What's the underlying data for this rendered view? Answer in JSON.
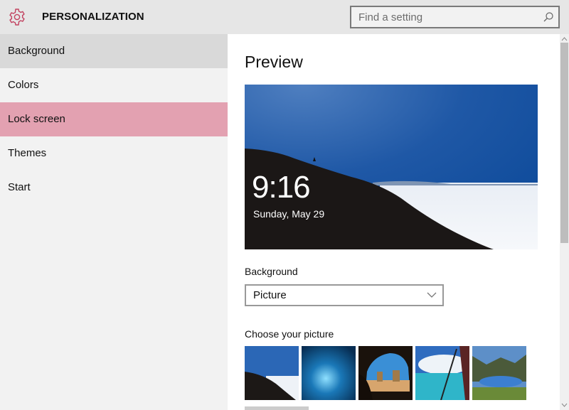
{
  "header": {
    "app_icon": "gear-icon",
    "title": "PERSONALIZATION",
    "search": {
      "placeholder": "Find a setting",
      "value": "",
      "icon": "search-icon"
    }
  },
  "sidebar": {
    "items": [
      {
        "label": "Background",
        "state": "hover"
      },
      {
        "label": "Colors",
        "state": "normal"
      },
      {
        "label": "Lock screen",
        "state": "selected"
      },
      {
        "label": "Themes",
        "state": "normal"
      },
      {
        "label": "Start",
        "state": "normal"
      }
    ]
  },
  "main": {
    "preview_title": "Preview",
    "lock_preview": {
      "time": "9:16",
      "date": "Sunday, May 29"
    },
    "background_label": "Background",
    "background_dropdown": {
      "selected": "Picture",
      "icon": "chevron-down-icon"
    },
    "choose_picture_label": "Choose your picture",
    "thumbnails": [
      {
        "name": "mountain-cyclist-clouds"
      },
      {
        "name": "ice-cave"
      },
      {
        "name": "sea-cave-beach"
      },
      {
        "name": "airplane-window-lake"
      },
      {
        "name": "mountain-lake-reflection"
      }
    ]
  },
  "colors": {
    "accent": "#e3a1b1",
    "gear": "#c2415f",
    "header_bg": "#e6e6e6",
    "sidebar_bg": "#f2f2f2"
  }
}
